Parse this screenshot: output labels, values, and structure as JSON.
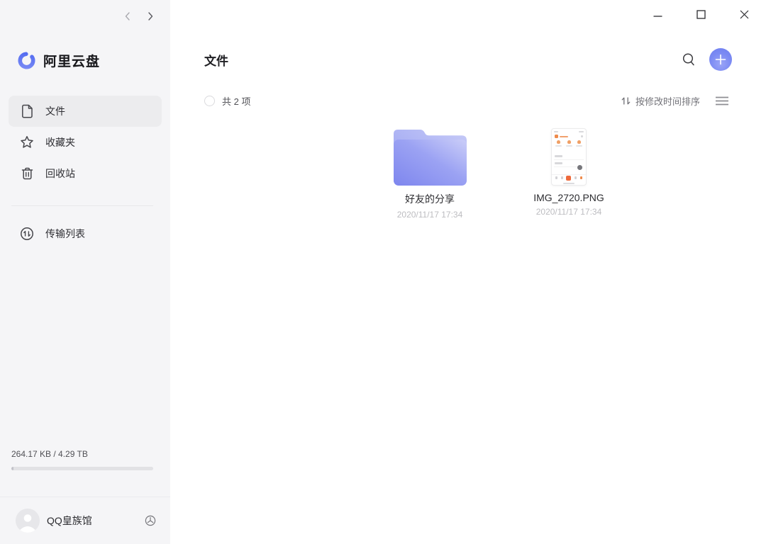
{
  "sidebar": {
    "brand": "阿里云盘",
    "items": [
      {
        "label": "文件"
      },
      {
        "label": "收藏夹"
      },
      {
        "label": "回收站"
      },
      {
        "label": "传输列表"
      }
    ],
    "storage_text": "264.17 KB / 4.29 TB",
    "storage_percent": 1.5,
    "user_name": "QQ皇族馆"
  },
  "header": {
    "title": "文件"
  },
  "toolbar": {
    "count_text": "共 2 项",
    "sort_label": "按修改时间排序"
  },
  "files": [
    {
      "name": "好友的分享",
      "date": "2020/11/17 17:34",
      "type": "folder"
    },
    {
      "name": "IMG_2720.PNG",
      "date": "2020/11/17 17:34",
      "type": "image"
    }
  ],
  "colors": {
    "accent": "#6f7ef1",
    "sidebar_bg": "#f5f5f7",
    "folder_dark": "#7d85ee",
    "folder_light": "#c9ccf8",
    "thumb_accent": "#ee8a4a"
  }
}
